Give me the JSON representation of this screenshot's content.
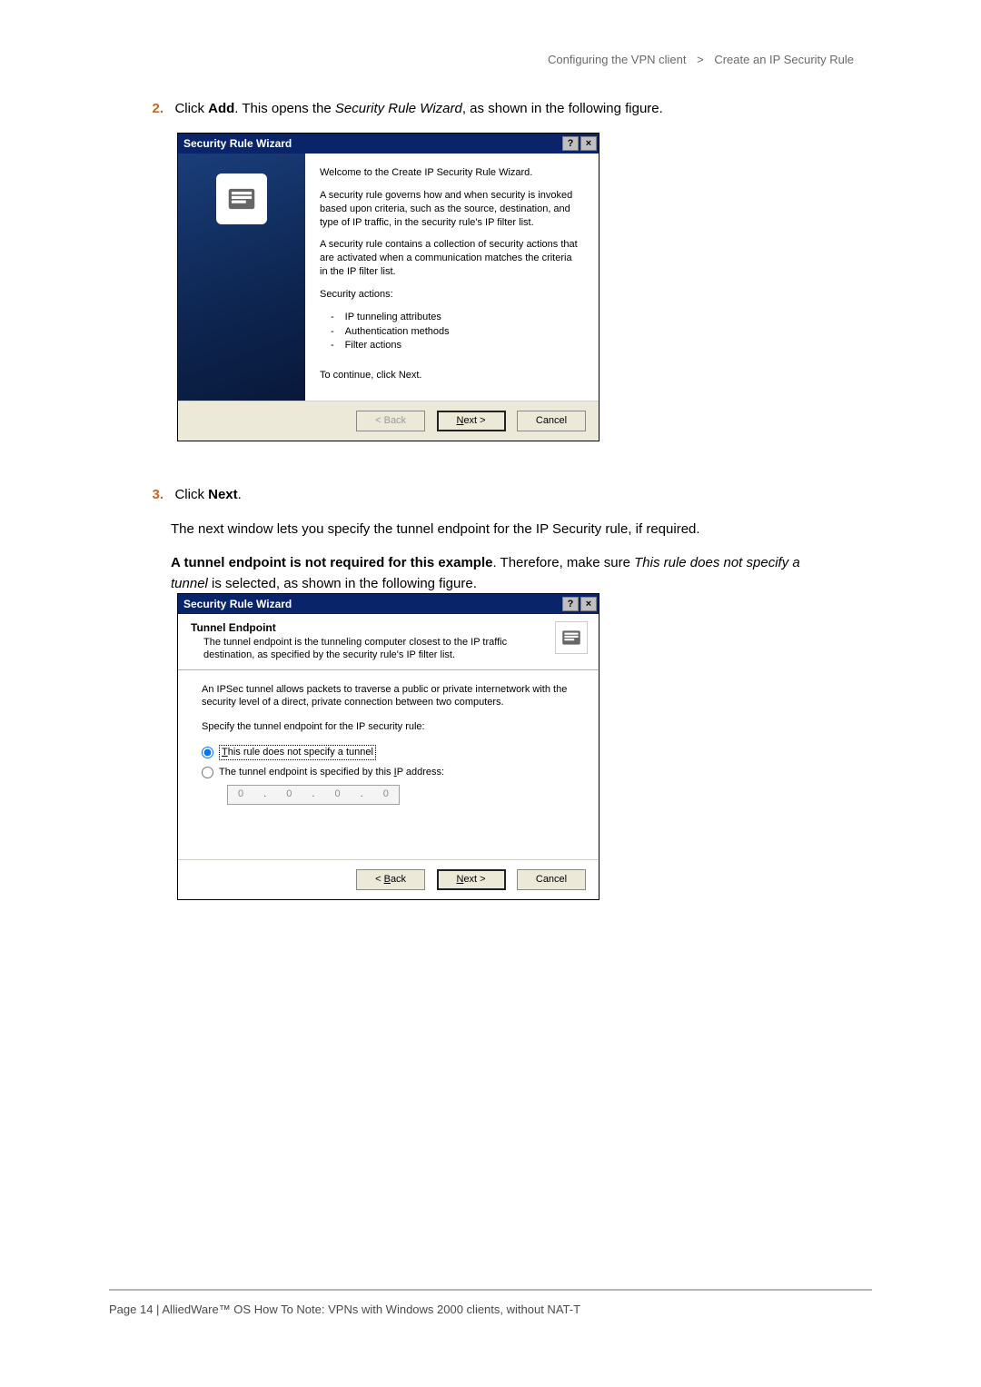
{
  "breadcrumb": {
    "part1": "Configuring the VPN client",
    "sep": ">",
    "part2": "Create an IP Security Rule"
  },
  "step2": {
    "num": "2.",
    "text_before": "Click ",
    "bold1": "Add",
    "text_mid": ". This opens the ",
    "italic1": "Security Rule Wizard",
    "text_after": ", as shown in the following figure."
  },
  "dialog1": {
    "title": "Security Rule Wizard",
    "p1": "Welcome to the Create IP Security Rule Wizard.",
    "p2": "A security rule governs how and when security is invoked based upon criteria, such as the source, destination, and type of IP traffic, in the security rule's IP filter list.",
    "p3": "A security rule contains a collection of security actions that are activated when a communication matches the criteria in the IP filter list.",
    "p4": "Security actions:",
    "li1": "IP tunneling attributes",
    "li2": "Authentication methods",
    "li3": "Filter actions",
    "p5": "To continue, click Next.",
    "back": "< Back",
    "next_pre": "N",
    "next_post": "ext >",
    "cancel": "Cancel",
    "help": "?",
    "close": "×"
  },
  "step3": {
    "num": "3.",
    "text_before": "Click ",
    "bold1": "Next",
    "text_after": ".",
    "para1": "The next window lets you specify the tunnel endpoint for the IP Security rule, if required.",
    "para2_bold": "A tunnel endpoint is not required for this example",
    "para2_mid": ". Therefore, make sure ",
    "para2_italic": "This rule does not specify a tunnel",
    "para2_after": " is selected, as shown in the following figure."
  },
  "dialog2": {
    "title": "Security Rule Wizard",
    "htitle": "Tunnel Endpoint",
    "hdesc": "The tunnel endpoint is the tunneling computer closest to the IP traffic destination, as specified by the security rule's IP filter list.",
    "body1": "An IPSec tunnel allows packets to traverse a public or private internetwork with the security level of a direct, private connection between two computers.",
    "body2": "Specify the tunnel endpoint for the IP security rule:",
    "radio1_pre": "T",
    "radio1_post": "his rule does not specify a tunnel",
    "radio2_pre": "The tunnel endpoint is specified by this ",
    "radio2_ul": "I",
    "radio2_post": "P address:",
    "ip1": "0",
    "ip2": "0",
    "ip3": "0",
    "ip4": "0",
    "back_pre": "< ",
    "back_ul": "B",
    "back_post": "ack",
    "next_pre": "N",
    "next_post": "ext >",
    "cancel": "Cancel",
    "help": "?",
    "close": "×"
  },
  "footer": "Page 14 | AlliedWare™ OS How To Note: VPNs with Windows 2000 clients, without NAT-T"
}
